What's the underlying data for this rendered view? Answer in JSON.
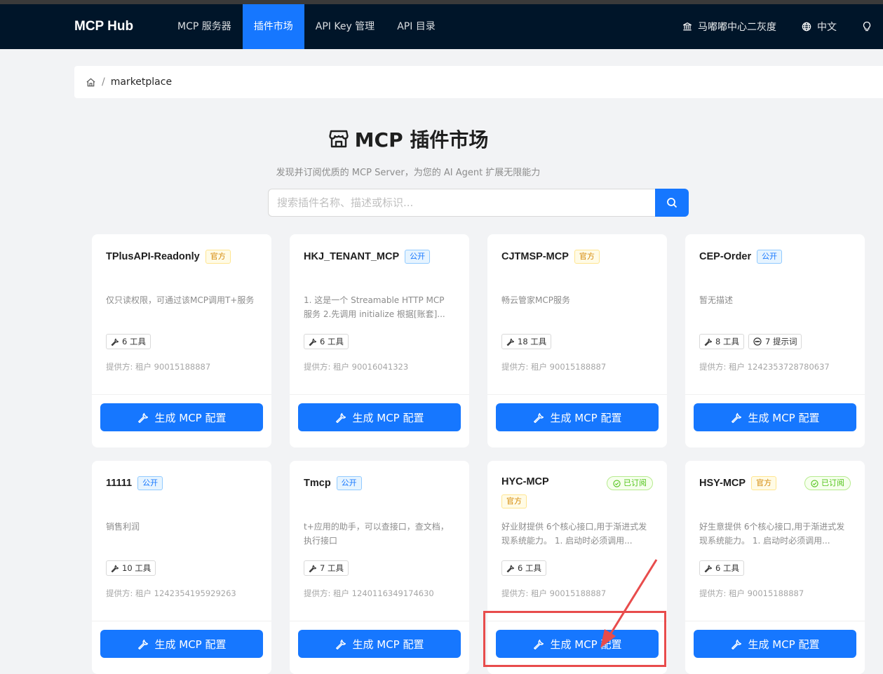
{
  "nav": {
    "brand": "MCP Hub",
    "items": [
      {
        "label": "MCP 服务器",
        "active": false
      },
      {
        "label": "插件市场",
        "active": true
      },
      {
        "label": "API Key 管理",
        "active": false
      },
      {
        "label": "API 目录",
        "active": false
      }
    ],
    "tenant": "马嘟嘟中心二灰度",
    "language": "中文"
  },
  "breadcrumb": {
    "separator": "/",
    "current": "marketplace"
  },
  "header": {
    "title": "MCP 插件市场",
    "subtitle": "发现并订阅优质的 MCP Server，为您的 AI Agent 扩展无限能力"
  },
  "search": {
    "placeholder": "搜索插件名称、描述或标识...",
    "value": ""
  },
  "cards": [
    {
      "title": "TPlusAPI-Readonly",
      "tag": {
        "type": "official",
        "label": "官方"
      },
      "subscribed": null,
      "description": "仅只读权限，可通过该MCP调用T+服务",
      "stats": [
        {
          "icon": "tool-icon",
          "label": "6 工具"
        }
      ],
      "provider": "提供方: 租户 90015188887",
      "button": "生成 MCP 配置"
    },
    {
      "title": "HKJ_TENANT_MCP",
      "tag": {
        "type": "public",
        "label": "公开"
      },
      "subscribed": null,
      "description": "1. 这是一个 Streamable HTTP MCP 服务 2.先调用 initialize 根据[账套]...",
      "stats": [
        {
          "icon": "tool-icon",
          "label": "6 工具"
        }
      ],
      "provider": "提供方: 租户 90016041323",
      "button": "生成 MCP 配置"
    },
    {
      "title": "CJTMSP-MCP",
      "tag": {
        "type": "official",
        "label": "官方"
      },
      "subscribed": null,
      "description": "畅云管家MCP服务",
      "stats": [
        {
          "icon": "tool-icon",
          "label": "18 工具"
        }
      ],
      "provider": "提供方: 租户 90015188887",
      "button": "生成 MCP 配置"
    },
    {
      "title": "CEP-Order",
      "tag": {
        "type": "public",
        "label": "公开"
      },
      "subscribed": null,
      "description": "暂无描述",
      "stats": [
        {
          "icon": "tool-icon",
          "label": "8 工具"
        },
        {
          "icon": "chat-icon",
          "label": "7 提示词"
        }
      ],
      "provider": "提供方: 租户 1242353728780637",
      "button": "生成 MCP 配置"
    },
    {
      "title": "11111",
      "tag": {
        "type": "public",
        "label": "公开"
      },
      "subscribed": null,
      "description": "销售利润",
      "stats": [
        {
          "icon": "tool-icon",
          "label": "10 工具"
        }
      ],
      "provider": "提供方: 租户 1242354195929263",
      "button": "生成 MCP 配置"
    },
    {
      "title": "Tmcp",
      "tag": {
        "type": "public",
        "label": "公开"
      },
      "subscribed": null,
      "description": "t+应用的助手，可以查接口，查文档， 执行接口",
      "stats": [
        {
          "icon": "tool-icon",
          "label": "7 工具"
        }
      ],
      "provider": "提供方: 租户 1240116349174630",
      "button": "生成 MCP 配置"
    },
    {
      "title": "HYC-MCP",
      "tag": {
        "type": "official",
        "label": "官方"
      },
      "tagBelow": true,
      "subscribed": "已订阅",
      "description": "好业财提供 6个核心接口,用于渐进式发现系统能力。 1. 启动时必须调用...",
      "stats": [
        {
          "icon": "tool-icon",
          "label": "6 工具"
        }
      ],
      "provider": "提供方: 租户 90015188887",
      "button": "生成 MCP 配置"
    },
    {
      "title": "HSY-MCP",
      "tag": {
        "type": "official",
        "label": "官方"
      },
      "subscribed": "已订阅",
      "description": "好生意提供 6个核心接口,用于渐进式发现系统能力。 1. 启动时必须调用...",
      "stats": [
        {
          "icon": "tool-icon",
          "label": "6 工具"
        }
      ],
      "provider": "提供方: 租户 90015188887",
      "button": "生成 MCP 配置"
    }
  ],
  "colors": {
    "nav_bg": "#001529",
    "primary": "#1677ff",
    "page_bg": "#f2f3f5",
    "annotation": "#e84c4c"
  }
}
